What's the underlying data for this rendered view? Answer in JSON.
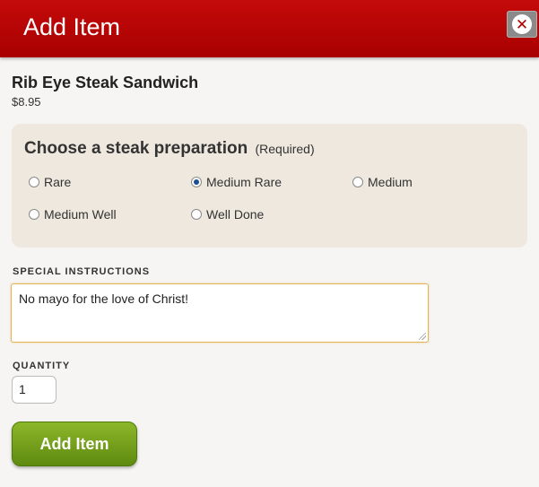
{
  "header": {
    "title": "Add Item",
    "close_symbol": "✕"
  },
  "item": {
    "name": "Rib Eye Steak Sandwich",
    "price": "$8.95"
  },
  "preparation": {
    "heading": "Choose a steak preparation",
    "required": "(Required)",
    "options": [
      {
        "label": "Rare",
        "checked": false
      },
      {
        "label": "Medium Rare",
        "checked": true
      },
      {
        "label": "Medium",
        "checked": false
      },
      {
        "label": "Medium Well",
        "checked": false
      },
      {
        "label": "Well Done",
        "checked": false
      }
    ]
  },
  "special_instructions": {
    "label": "SPECIAL INSTRUCTIONS",
    "value": "No mayo for the love of Christ!"
  },
  "quantity": {
    "label": "QUANTITY",
    "value": "1"
  },
  "add_button": {
    "label": "Add Item"
  },
  "colors": {
    "header": "#b30000",
    "accent_button": "#76a11d",
    "panel": "#eee8df"
  },
  "icons": {
    "close": "close-icon"
  }
}
